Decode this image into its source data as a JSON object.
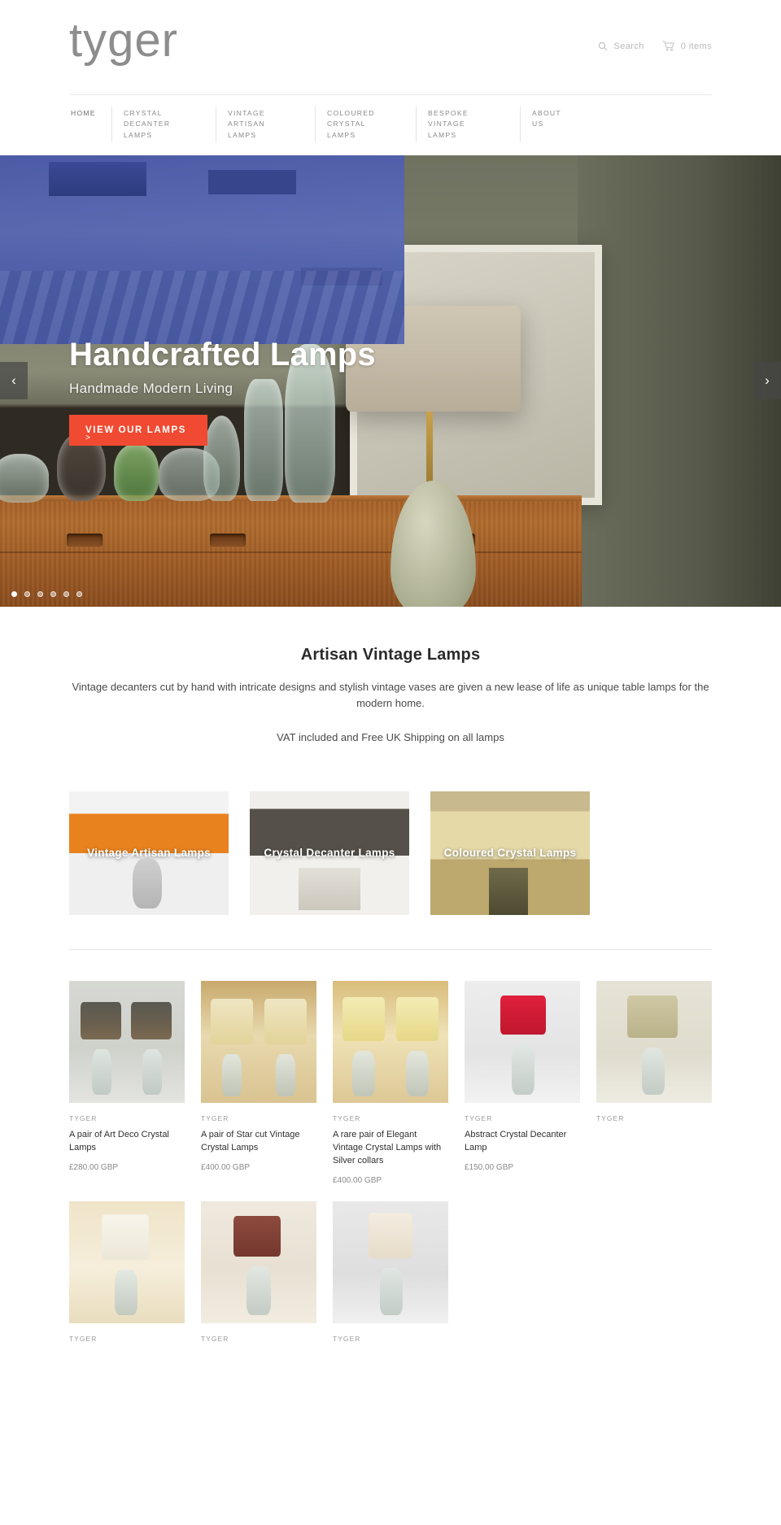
{
  "header": {
    "logo": "tyger",
    "search_label": "Search",
    "cart_label": "0 items"
  },
  "nav": {
    "items": [
      {
        "label": "HOME"
      },
      {
        "label": "CRYSTAL DECANTER\nLAMPS"
      },
      {
        "label": "VINTAGE ARTISAN\nLAMPS"
      },
      {
        "label": "COLOURED CRYSTAL\nLAMPS"
      },
      {
        "label": "BESPOKE VINTAGE\nLAMPS"
      },
      {
        "label": "ABOUT\nUS"
      }
    ]
  },
  "hero": {
    "title": "Handcrafted Lamps",
    "subtitle": "Handmade Modern Living",
    "button": "VIEW OUR LAMPS",
    "button_chevron": ">",
    "prev_arrow": "‹",
    "next_arrow": "›",
    "dots": 6,
    "active_dot": 0,
    "accent_color": "#f04a32"
  },
  "intro": {
    "heading": "Artisan Vintage Lamps",
    "paragraph": "Vintage decanters cut by hand with intricate designs and stylish vintage vases are given a new lease of life as unique table lamps for the modern home.",
    "vat_note": "VAT included and Free UK Shipping on all lamps"
  },
  "categories": [
    {
      "label": "Vintage Artisan Lamps"
    },
    {
      "label": "Crystal Decanter Lamps"
    },
    {
      "label": "Coloured Crystal Lamps"
    }
  ],
  "products": [
    {
      "vendor": "TYGER",
      "title": "A pair of Art Deco Crystal Lamps",
      "price": "£280.00 GBP"
    },
    {
      "vendor": "TYGER",
      "title": "A pair of Star cut Vintage Crystal Lamps",
      "price": "£400.00 GBP"
    },
    {
      "vendor": "TYGER",
      "title": "A rare pair of Elegant Vintage Crystal Lamps with Silver collars",
      "price": "£400.00 GBP"
    },
    {
      "vendor": "TYGER",
      "title": "Abstract Crystal Decanter Lamp",
      "price": "£150.00 GBP"
    },
    {
      "vendor": "TYGER",
      "title": "",
      "price": ""
    },
    {
      "vendor": "TYGER",
      "title": "",
      "price": ""
    },
    {
      "vendor": "TYGER",
      "title": "",
      "price": ""
    },
    {
      "vendor": "TYGER",
      "title": "",
      "price": ""
    }
  ]
}
